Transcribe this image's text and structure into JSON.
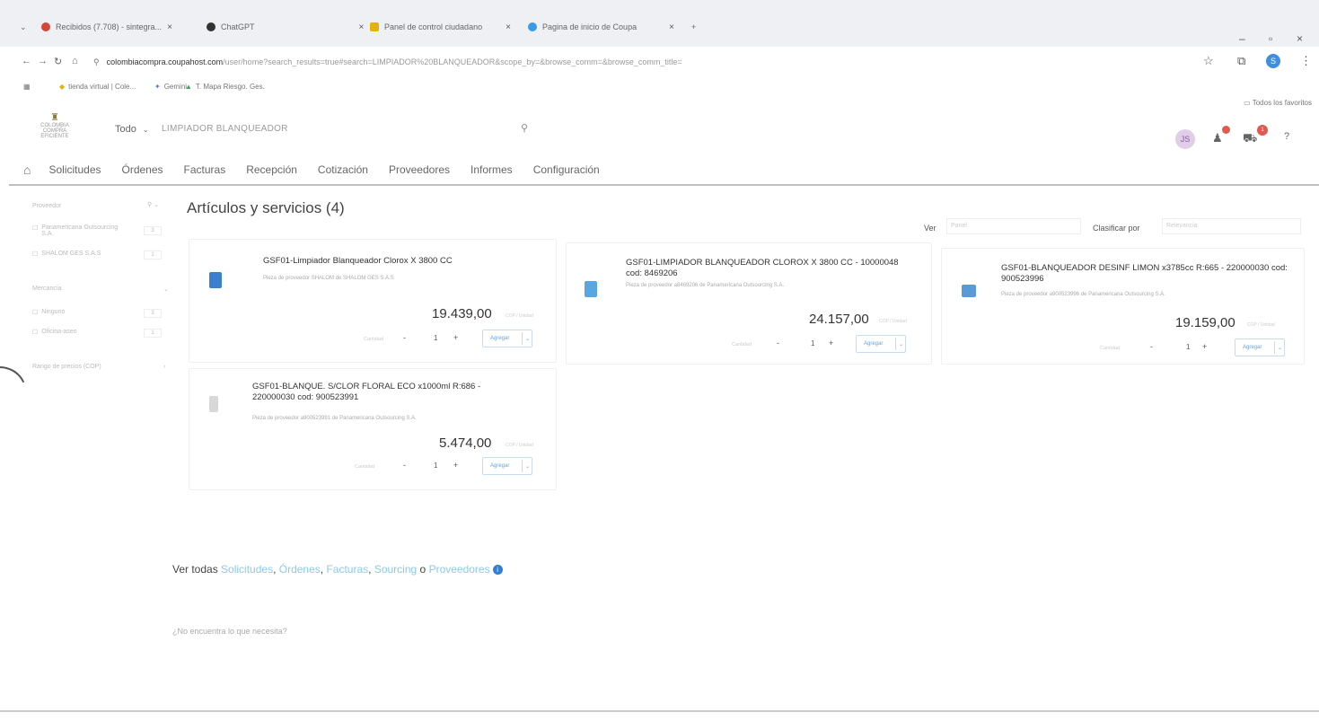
{
  "browser": {
    "tabs": [
      {
        "title": "Recibidos (7.708) - sintegra...",
        "color": "#d44638"
      },
      {
        "title": "ChatGPT",
        "color": "#333333"
      },
      {
        "title": "Panel de control ciudadano",
        "color": "#e3b30a"
      },
      {
        "title": "Pagina de inicio de Coupa",
        "color": "#3a9ae8"
      }
    ],
    "new_tab": "+",
    "url_host": "colombiacompra.coupahost.com",
    "url_path": "/user/home?search_results=true#search=LIMPIADOR%20BLANQUEADOR&scope_by=&browse_comm=&browse_comm_title=",
    "profile_initial": "S",
    "bookmarks": [
      "tienda virtual | Cole...",
      "Gemini",
      "T. Mapa Riesgo. Ges."
    ],
    "other_favorites": "Todos los favoritos"
  },
  "header": {
    "logo_text": "COLOMBIA COMPRA EFICIENTE",
    "search_scope": "Todo",
    "search_value": "LIMPIADOR BLANQUEADOR",
    "avatar_initials": "JS",
    "cart_badge": "1",
    "help": "?"
  },
  "nav": [
    "Solicitudes",
    "Órdenes",
    "Facturas",
    "Recepción",
    "Cotización",
    "Proveedores",
    "Informes",
    "Configuración"
  ],
  "sidebar": {
    "proveedor_label": "Proveedor",
    "proveedores": [
      {
        "name": "Panamericana Outsourcing S.A.",
        "count": "3"
      },
      {
        "name": "SHALOM GES S.A.S",
        "count": "1"
      }
    ],
    "mercancia_label": "Mercancía",
    "mercancia": [
      {
        "name": "Ninguno",
        "count": "3"
      },
      {
        "name": "Oficina-aseo",
        "count": "1"
      }
    ],
    "rango_label": "Rango de precios (COP)"
  },
  "content": {
    "title": "Artículos y servicios (4)",
    "view_label": "Ver",
    "view_value": "Panel",
    "sort_label": "Clasificar por",
    "sort_value": "Relevancia",
    "qty_label": "Cantidad",
    "add_label": "Agregar",
    "items": [
      {
        "title": "GSF01-Limpiador Blanqueador Clorox X 3800 CC",
        "supplier": "Pieza de proveedor SHALOM de SHALOM GES S.A.S",
        "price": "19.439,00",
        "unit": "COP / Unidad",
        "qty": "1",
        "color": "#3d7fcf"
      },
      {
        "title": "GSF01-LIMPIADOR BLANQUEADOR CLOROX X 3800 CC - 10000048 cod: 8469206",
        "supplier": "Pieza de proveedor a8469206 de Panamericana Outsourcing S.A.",
        "price": "24.157,00",
        "unit": "COP / Unidad",
        "qty": "1",
        "color": "#5aa6e0"
      },
      {
        "title": "GSF01-BLANQUEADOR DESINF LIMON x3785cc R:665 - 220000030 cod: 900523996",
        "supplier": "Pieza de proveedor a900523996 de Panamericana Outsourcing S.A.",
        "price": "19.159,00",
        "unit": "COP / Unidad",
        "qty": "1",
        "color": "#5a9ad6"
      },
      {
        "title": "GSF01-BLANQUE. S/CLOR FLORAL ECO x1000ml R:686 - 220000030 cod: 900523991",
        "supplier": "Pieza de proveedor a900523991 de Panamericana Outsourcing S.A.",
        "price": "5.474,00",
        "unit": "COP / Unidad",
        "qty": "1",
        "color": "#c9c9c9"
      }
    ]
  },
  "footer": {
    "see_all_prefix": "Ver todas",
    "links": [
      "Solicitudes",
      "Órdenes",
      "Facturas",
      "Sourcing",
      "Proveedores"
    ],
    "or_word": "o",
    "not_found": "¿No encuentra lo que necesita?"
  }
}
